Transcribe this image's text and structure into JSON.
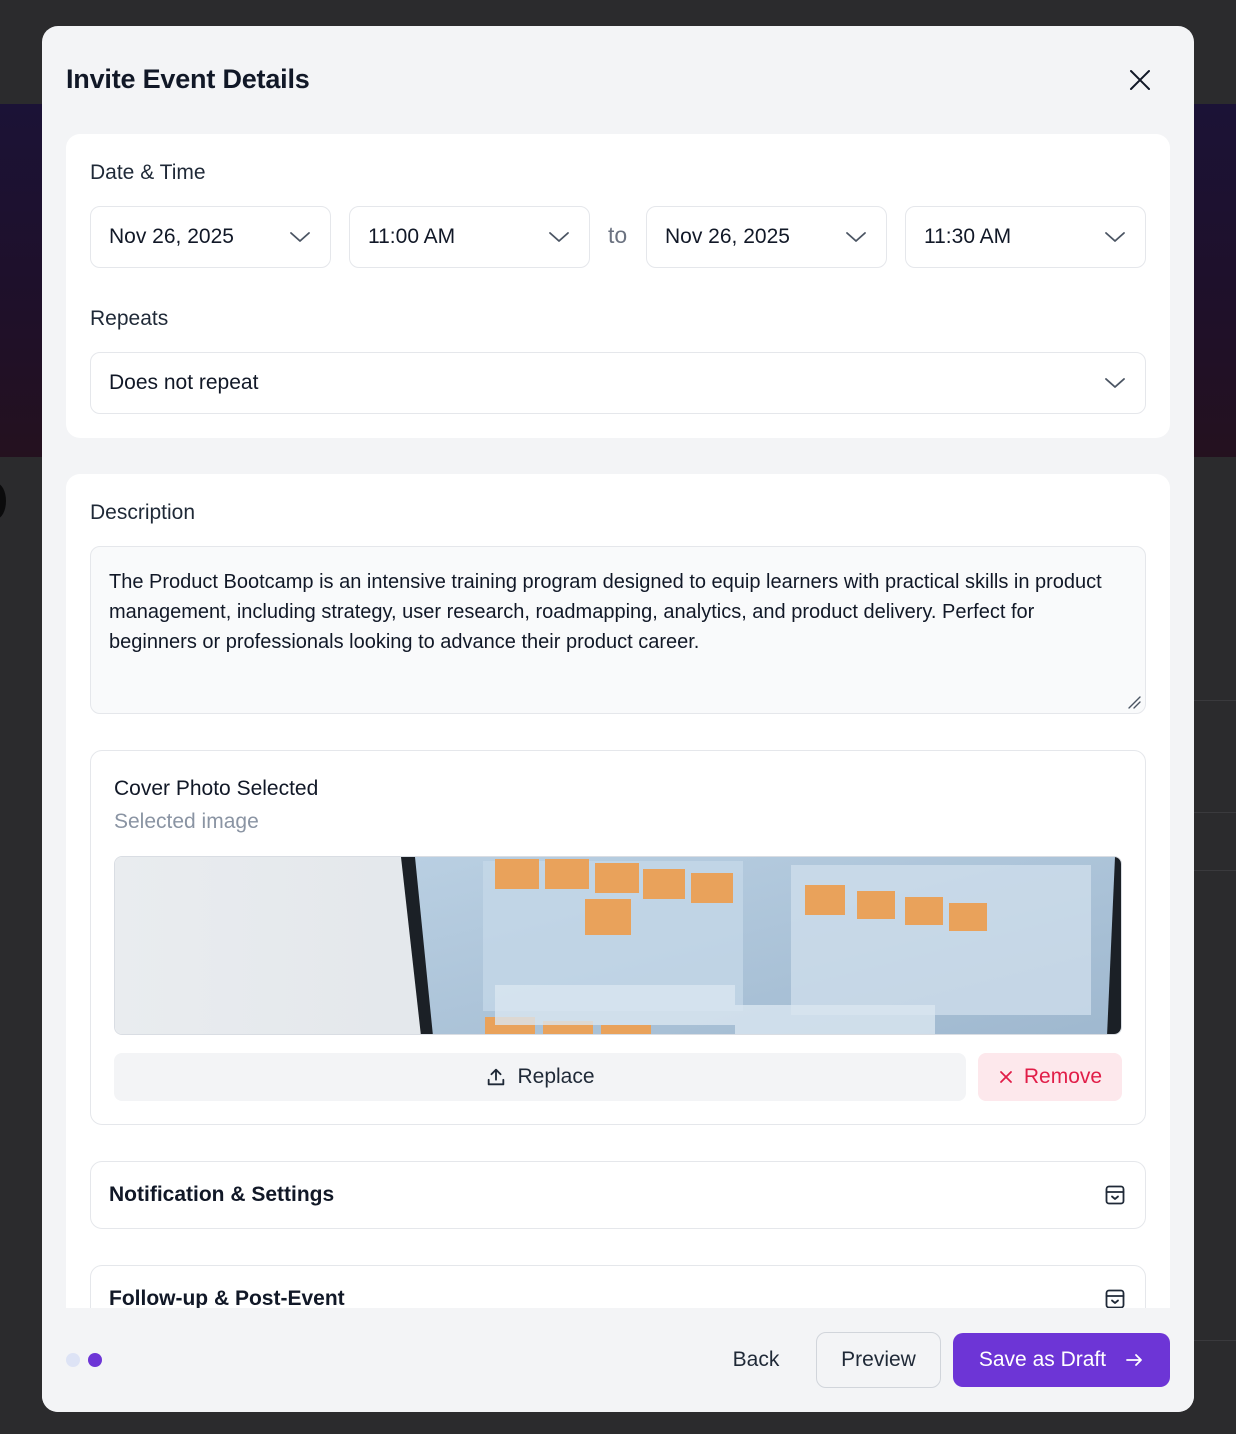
{
  "modal": {
    "title": "Invite Event Details"
  },
  "date_time": {
    "label": "Date & Time",
    "start_date": "Nov 26, 2025",
    "start_time": "11:00 AM",
    "separator": "to",
    "end_date": "Nov 26, 2025",
    "end_time": "11:30 AM"
  },
  "repeats": {
    "label": "Repeats",
    "value": "Does not repeat"
  },
  "description": {
    "label": "Description",
    "value": "The Product Bootcamp is an intensive training program designed to equip learners with practical skills in product management, including strategy, user research, roadmapping, analytics, and product delivery. Perfect for beginners or professionals looking to advance their product career."
  },
  "cover_photo": {
    "title": "Cover Photo Selected",
    "subtitle": "Selected image",
    "replace_label": "Replace",
    "remove_label": "Remove"
  },
  "sections": {
    "notification": "Notification & Settings",
    "followup": "Follow-up & Post-Event"
  },
  "footer": {
    "steps_total": 2,
    "current_step": 2,
    "back_label": "Back",
    "preview_label": "Preview",
    "save_draft_label": "Save as Draft"
  },
  "colors": {
    "accent": "#6d35d6",
    "danger": "#e11d48",
    "danger_bg": "#fde8ec",
    "inactive_dot": "#dde3f5"
  }
}
